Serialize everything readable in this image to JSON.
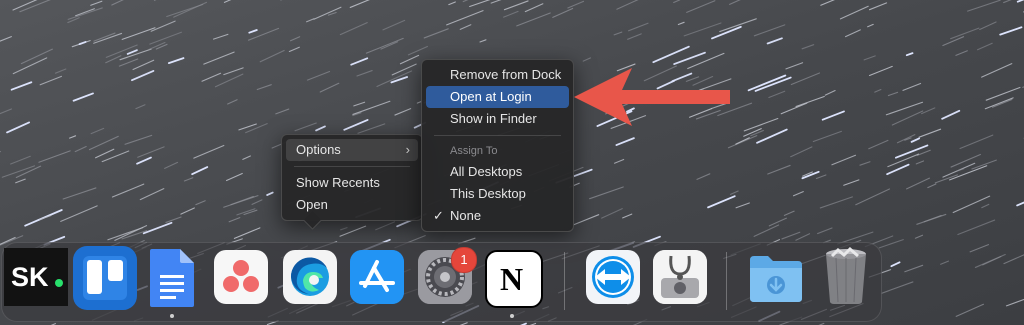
{
  "context_menu": {
    "items": [
      {
        "label": "Options"
      },
      {
        "label": "Show Recents"
      },
      {
        "label": "Open"
      }
    ]
  },
  "options_submenu": {
    "items": [
      {
        "label": "Remove from Dock"
      },
      {
        "label": "Open at Login"
      },
      {
        "label": "Show in Finder"
      }
    ],
    "assign_header": "Assign To",
    "assign_items": [
      {
        "label": "All Desktops"
      },
      {
        "label": "This Desktop"
      },
      {
        "label": "None"
      }
    ],
    "checked": "None",
    "highlighted": "Open at Login"
  },
  "annotation_arrow": {
    "color": "#e8564a"
  },
  "dock": {
    "apps": [
      {
        "name": "SK.",
        "icon": "sk-logo-icon",
        "running": false
      },
      {
        "name": "Trello",
        "icon": "trello-icon",
        "running": false
      },
      {
        "name": "Google Docs",
        "icon": "google-docs-icon",
        "running": true
      },
      {
        "name": "Asana",
        "icon": "asana-icon",
        "running": false
      },
      {
        "name": "Microsoft Edge",
        "icon": "edge-icon",
        "running": false
      },
      {
        "name": "App Store",
        "icon": "app-store-icon",
        "running": false
      },
      {
        "name": "System Preferences",
        "icon": "system-preferences-icon",
        "running": false,
        "badge": "1"
      },
      {
        "name": "Notion",
        "icon": "notion-icon",
        "running": true
      },
      {
        "name": "TeamViewer",
        "icon": "teamviewer-icon",
        "running": false
      },
      {
        "name": "Disk Utility",
        "icon": "disk-utility-icon",
        "running": false
      },
      {
        "name": "Downloads",
        "icon": "downloads-folder-icon",
        "running": false
      },
      {
        "name": "Trash",
        "icon": "trash-icon",
        "running": false
      }
    ]
  },
  "sk_logo": {
    "text": "SK",
    "dot": "."
  },
  "notion_letter": "N"
}
